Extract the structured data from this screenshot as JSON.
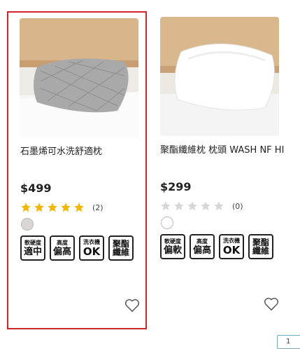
{
  "products": [
    {
      "title": "石墨烯可水洗舒適枕",
      "price": "$499",
      "rating": 5,
      "review_count": "(2)",
      "swatch_color": "#d9d6d3",
      "badges": [
        {
          "top": "軟硬度",
          "bottom": "適中"
        },
        {
          "top": "高度",
          "bottom": "偏高"
        },
        {
          "top": "洗衣機",
          "bottom": "OK"
        },
        {
          "top": "聚酯",
          "bottom": "纖維"
        }
      ],
      "image_icon": "gray-quilted-pillow-image"
    },
    {
      "title": "聚酯纖維枕 枕頭 WASH NF HI",
      "price": "$299",
      "rating": 0,
      "review_count": "(0)",
      "swatch_color": "#ffffff",
      "badges": [
        {
          "top": "軟硬度",
          "bottom": "偏軟"
        },
        {
          "top": "高度",
          "bottom": "偏高"
        },
        {
          "top": "洗衣機",
          "bottom": "OK"
        },
        {
          "top": "聚酯",
          "bottom": "纖維"
        }
      ],
      "image_icon": "white-pillow-image"
    }
  ],
  "pager": {
    "label": "1"
  },
  "colors": {
    "selected_border": "#d0242b",
    "star_filled": "#f2b705",
    "star_empty": "#d7d7d7"
  }
}
